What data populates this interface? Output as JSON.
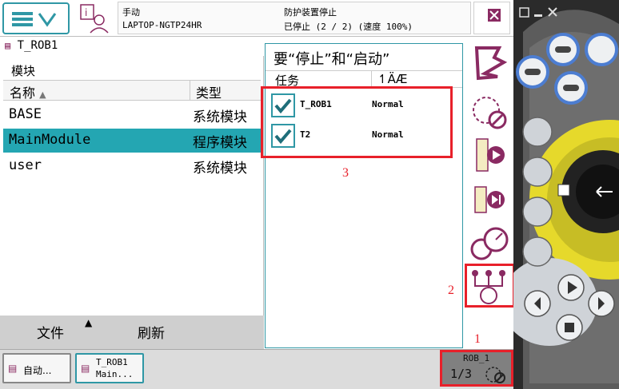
{
  "header": {
    "mode": "手动",
    "host": "LAPTOP-NGTP24HR",
    "guard_status": "防护装置停止",
    "run_status": "已停止 (2 / 2) (速度 100%)"
  },
  "left_panel": {
    "robot_title": "T_ROB1",
    "subtitle": "模块",
    "columns": [
      "名称",
      "类型"
    ],
    "rows": [
      {
        "name": "BASE",
        "type": "系统模块",
        "selected": false
      },
      {
        "name": "MainModule",
        "type": "程序模块",
        "selected": true
      },
      {
        "name": "user",
        "type": "系统模块",
        "selected": false
      }
    ],
    "file_label": "文件",
    "refresh_label": "刷新"
  },
  "popup": {
    "title": "要“停止”和“启动”",
    "col_task": "任务",
    "col_mode": "ÄÆ",
    "tasks": [
      {
        "name": "T_ROB1",
        "mode": "Normal",
        "checked": true
      },
      {
        "name": "T2",
        "mode": "Normal",
        "checked": true
      }
    ]
  },
  "annotations": {
    "one": "1",
    "two": "2",
    "three": "3"
  },
  "taskbar": {
    "auto_label": "自动...",
    "prog_line1": "T_ROB1",
    "prog_line2": "Main...",
    "rob_label": "ROB_1",
    "rob_fraction": "1/3"
  },
  "colors": {
    "accent": "#2f97a5",
    "highlight": "#e8202a",
    "selection": "#24a6b2"
  }
}
